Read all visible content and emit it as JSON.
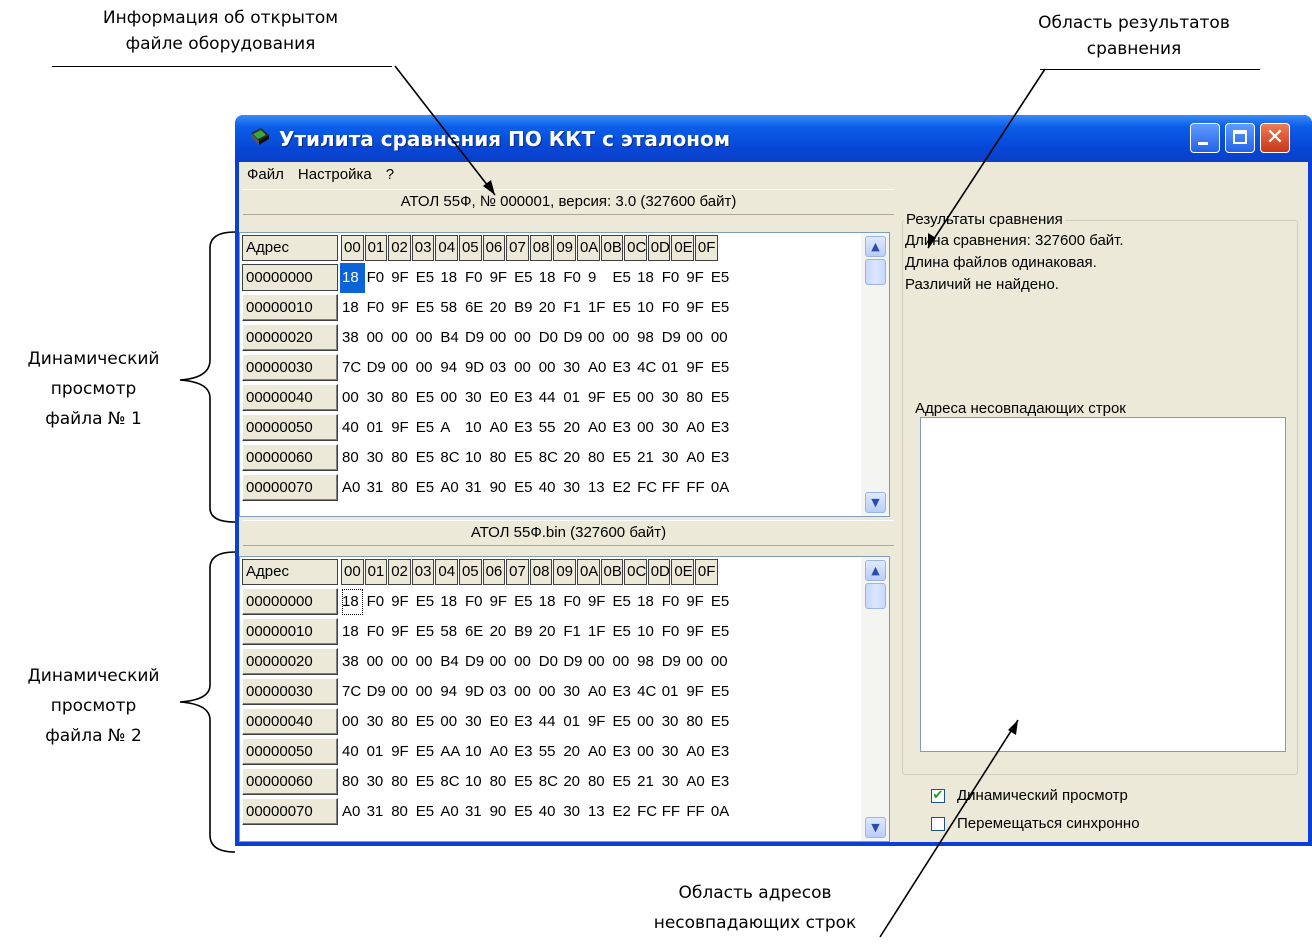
{
  "annotations": {
    "file_info": [
      "Информация об открытом",
      "файле оборудования"
    ],
    "results_area": [
      "Область результатов",
      "сравнения"
    ],
    "view1": [
      "Динамический",
      "просмотр",
      "файла № 1"
    ],
    "view2": [
      "Динамический",
      "просмотр",
      "файла № 2"
    ],
    "addr_area": [
      "Область адресов",
      "несовпадающих строк"
    ]
  },
  "window": {
    "title": "Утилита сравнения ПО ККТ с эталоном",
    "menu": [
      "Файл",
      "Настройка",
      "?"
    ]
  },
  "panel1": {
    "title": "АТОЛ 55Ф, № 000001, версия: 3.0 (327600 байт)",
    "header": [
      "Адрес",
      "00",
      "01",
      "02",
      "03",
      "04",
      "05",
      "06",
      "07",
      "08",
      "09",
      "0A",
      "0B",
      "0C",
      "0D",
      "0E",
      "0F"
    ],
    "rows": [
      {
        "addr": "00000000",
        "bytes": [
          "18",
          "F0",
          "9F",
          "E5",
          "18",
          "F0",
          "9F",
          "E5",
          "18",
          "F0",
          "9",
          "E5",
          "18",
          "F0",
          "9F",
          "E5"
        ]
      },
      {
        "addr": "00000010",
        "bytes": [
          "18",
          "F0",
          "9F",
          "E5",
          "58",
          "6E",
          "20",
          "B9",
          "20",
          "F1",
          "1F",
          "E5",
          "10",
          "F0",
          "9F",
          "E5"
        ]
      },
      {
        "addr": "00000020",
        "bytes": [
          "38",
          "00",
          "00",
          "00",
          "B4",
          "D9",
          "00",
          "00",
          "D0",
          "D9",
          "00",
          "00",
          "98",
          "D9",
          "00",
          "00"
        ]
      },
      {
        "addr": "00000030",
        "bytes": [
          "7C",
          "D9",
          "00",
          "00",
          "94",
          "9D",
          "03",
          "00",
          "00",
          "30",
          "A0",
          "E3",
          "4C",
          "01",
          "9F",
          "E5"
        ]
      },
      {
        "addr": "00000040",
        "bytes": [
          "00",
          "30",
          "80",
          "E5",
          "00",
          "30",
          "E0",
          "E3",
          "44",
          "01",
          "9F",
          "E5",
          "00",
          "30",
          "80",
          "E5"
        ]
      },
      {
        "addr": "00000050",
        "bytes": [
          "40",
          "01",
          "9F",
          "E5",
          "A",
          "10",
          "A0",
          "E3",
          "55",
          "20",
          "A0",
          "E3",
          "00",
          "30",
          "A0",
          "E3"
        ]
      },
      {
        "addr": "00000060",
        "bytes": [
          "80",
          "30",
          "80",
          "E5",
          "8C",
          "10",
          "80",
          "E5",
          "8C",
          "20",
          "80",
          "E5",
          "21",
          "30",
          "A0",
          "E3"
        ]
      },
      {
        "addr": "00000070",
        "bytes": [
          "A0",
          "31",
          "80",
          "E5",
          "A0",
          "31",
          "90",
          "E5",
          "40",
          "30",
          "13",
          "E2",
          "FC",
          "FF",
          "FF",
          "0A"
        ]
      }
    ]
  },
  "panel2": {
    "title": "АТОЛ 55Ф.bin (327600 байт)",
    "header": [
      "Адрес",
      "00",
      "01",
      "02",
      "03",
      "04",
      "05",
      "06",
      "07",
      "08",
      "09",
      "0A",
      "0B",
      "0C",
      "0D",
      "0E",
      "0F"
    ],
    "rows": [
      {
        "addr": "00000000",
        "bytes": [
          "18",
          "F0",
          "9F",
          "E5",
          "18",
          "F0",
          "9F",
          "E5",
          "18",
          "F0",
          "9F",
          "E5",
          "18",
          "F0",
          "9F",
          "E5"
        ]
      },
      {
        "addr": "00000010",
        "bytes": [
          "18",
          "F0",
          "9F",
          "E5",
          "58",
          "6E",
          "20",
          "B9",
          "20",
          "F1",
          "1F",
          "E5",
          "10",
          "F0",
          "9F",
          "E5"
        ]
      },
      {
        "addr": "00000020",
        "bytes": [
          "38",
          "00",
          "00",
          "00",
          "B4",
          "D9",
          "00",
          "00",
          "D0",
          "D9",
          "00",
          "00",
          "98",
          "D9",
          "00",
          "00"
        ]
      },
      {
        "addr": "00000030",
        "bytes": [
          "7C",
          "D9",
          "00",
          "00",
          "94",
          "9D",
          "03",
          "00",
          "00",
          "30",
          "A0",
          "E3",
          "4C",
          "01",
          "9F",
          "E5"
        ]
      },
      {
        "addr": "00000040",
        "bytes": [
          "00",
          "30",
          "80",
          "E5",
          "00",
          "30",
          "E0",
          "E3",
          "44",
          "01",
          "9F",
          "E5",
          "00",
          "30",
          "80",
          "E5"
        ]
      },
      {
        "addr": "00000050",
        "bytes": [
          "40",
          "01",
          "9F",
          "E5",
          "AA",
          "10",
          "A0",
          "E3",
          "55",
          "20",
          "A0",
          "E3",
          "00",
          "30",
          "A0",
          "E3"
        ]
      },
      {
        "addr": "00000060",
        "bytes": [
          "80",
          "30",
          "80",
          "E5",
          "8C",
          "10",
          "80",
          "E5",
          "8C",
          "20",
          "80",
          "E5",
          "21",
          "30",
          "A0",
          "E3"
        ]
      },
      {
        "addr": "00000070",
        "bytes": [
          "A0",
          "31",
          "80",
          "E5",
          "A0",
          "31",
          "90",
          "E5",
          "40",
          "30",
          "13",
          "E2",
          "FC",
          "FF",
          "FF",
          "0A"
        ]
      }
    ]
  },
  "results": {
    "legend": "Результаты сравнения",
    "lines": [
      "Длина сравнения: 327600 байт.",
      "Длина файлов одинаковая.",
      "Различий не найдено."
    ],
    "mismatch_label": "Адреса несовпадающих строк",
    "dynamic_view": {
      "label": "Динамический просмотр",
      "checked": true
    },
    "sync_move": {
      "label": "Перемещаться синхронно",
      "checked": false
    }
  },
  "icons": {
    "scroll_up": "chevron-up-icon",
    "scroll_down": "chevron-down-icon",
    "app": "chip-icon"
  }
}
